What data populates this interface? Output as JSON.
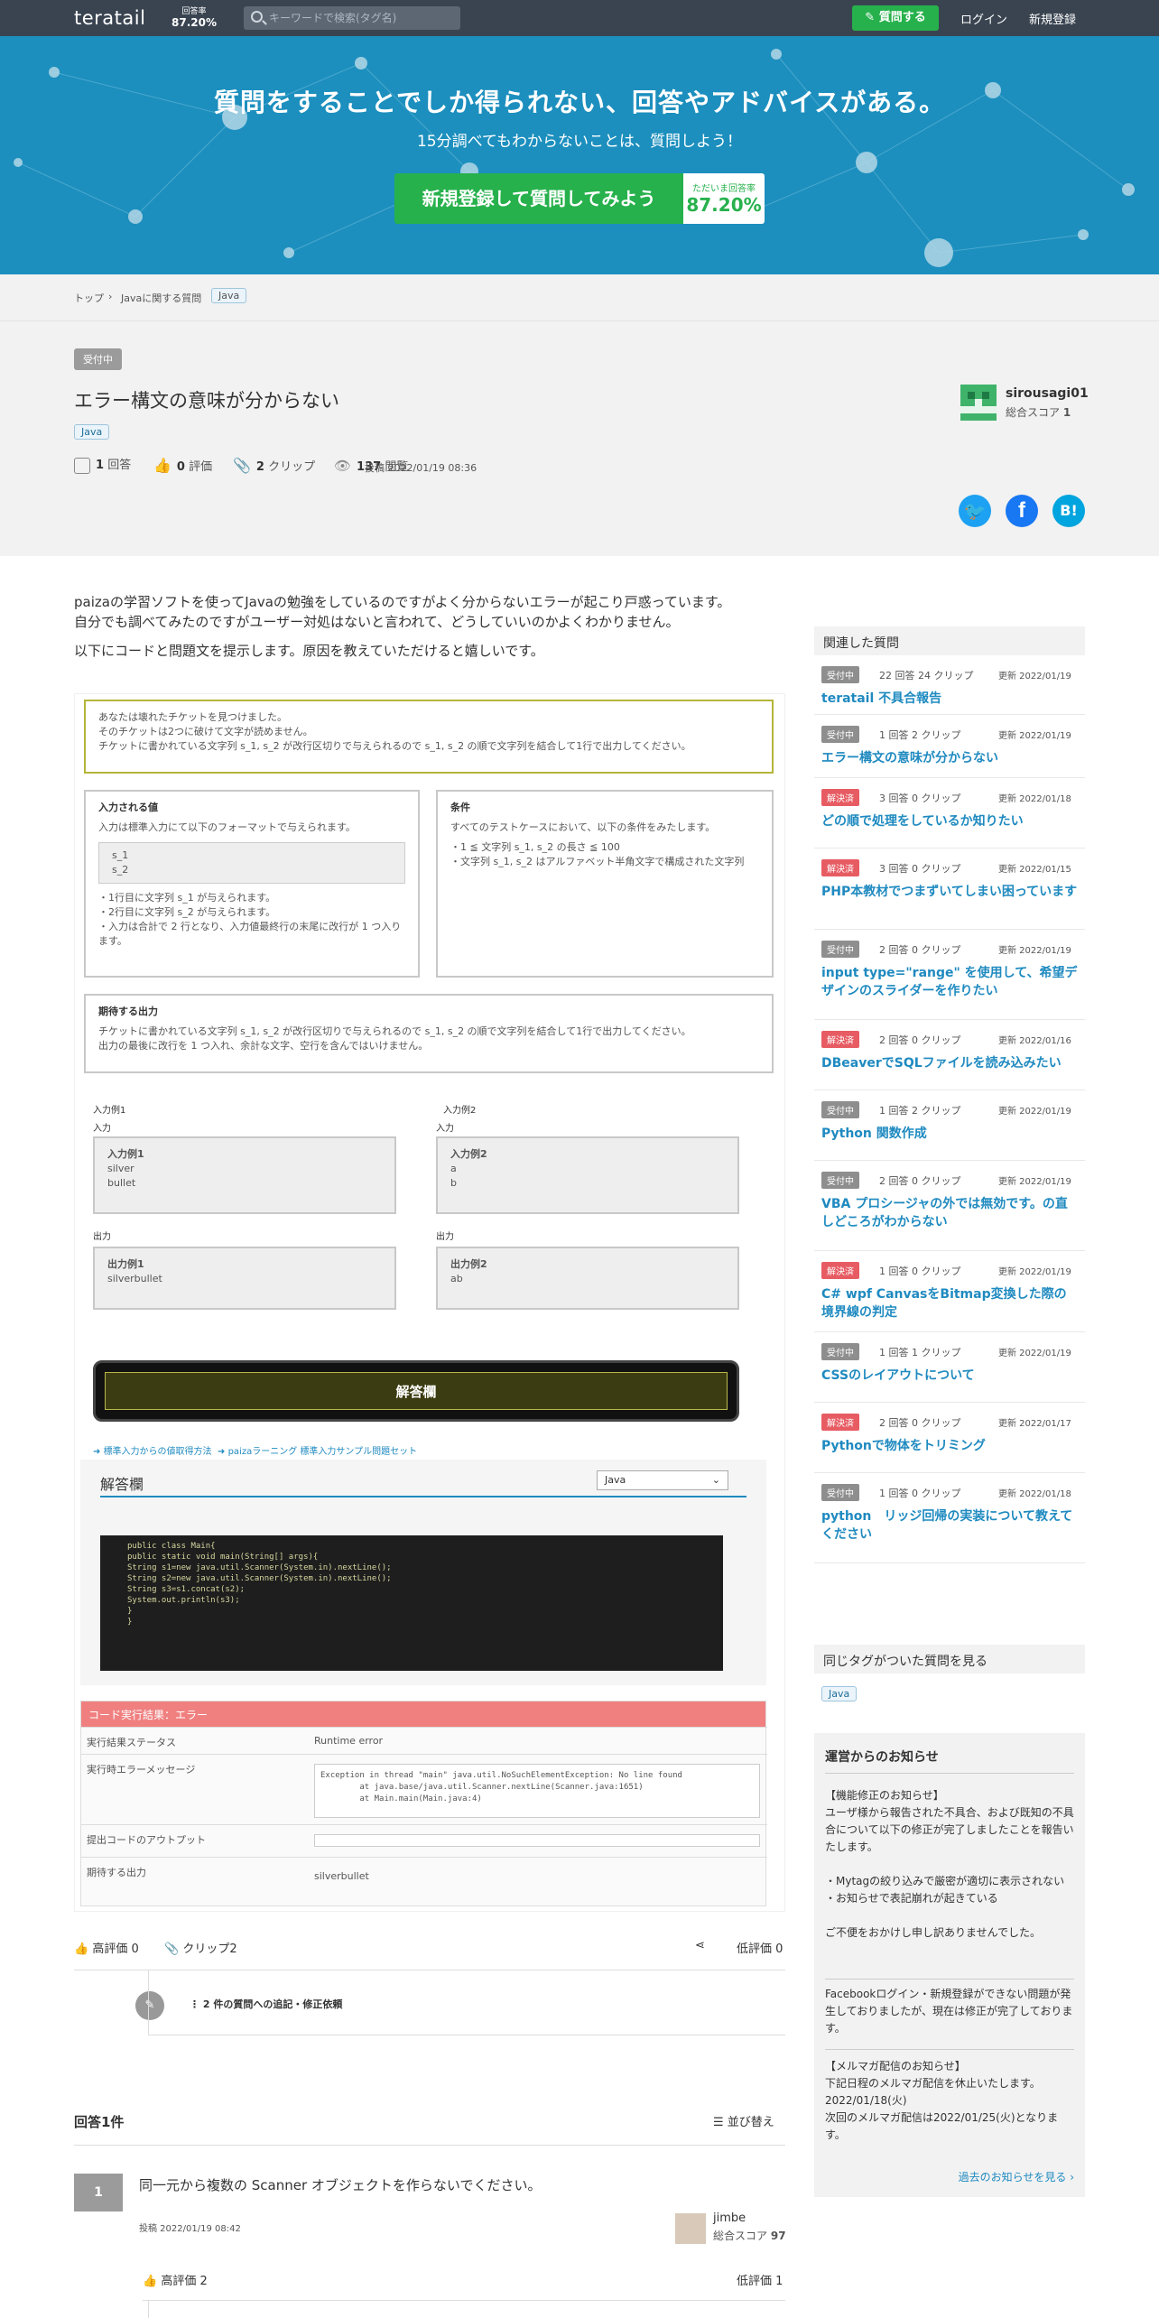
{
  "header": {
    "logo": "teratail",
    "rate_label": "回答率",
    "rate_value": "87.20%",
    "search_placeholder": "キーワードで検索(タグ名)",
    "ask_label": "質問する",
    "login_label": "ログイン",
    "signup_label": "新規登録"
  },
  "hero": {
    "title": "質問をすることでしか得られない、回答やアドバイスがある。",
    "subtitle": "15分調べてもわからないことは、質問しよう！",
    "cta_label": "新規登録して質問してみよう",
    "cta_rate_label": "ただいま回答率",
    "cta_rate_value": "87.20%"
  },
  "breadcrumb": {
    "top": "トップ",
    "category": "Javaに関する質問",
    "tag": "Java"
  },
  "question": {
    "status": "受付中",
    "title": "エラー構文の意味が分からない",
    "tag": "Java",
    "answers": "1",
    "answers_label": "回答",
    "votes": "0",
    "votes_label": "評価",
    "clips": "2",
    "clips_label": "クリップ",
    "views": "137",
    "views_label": "閲覧",
    "posted": "投稿 2022/01/19 08:36",
    "user_name": "sirousagi01",
    "user_score_label": "総合スコア",
    "user_score": "1"
  },
  "body": {
    "p1": "paizaの学習ソフトを使ってJavaの勉強をしているのですがよく分からないエラーが起こり戸惑っています。",
    "p2": "自分でも調べてみたのですがユーザー対処はないと言われて、どうしていいのかよくわかりません。",
    "p3": "以下にコードと問題文を提示します。原因を教えていただけると嬉しいです。"
  },
  "screenshot": {
    "intro1": "あなたは壊れたチケットを見つけました。",
    "intro2": "そのチケットは2つに破けて文字が読めません。",
    "intro3": "チケットに書かれている文字列 s_1, s_2 が改行区切りで与えられるので s_1, s_2 の順で文字列を結合して1行で出力してください。",
    "input_h": "入力される値",
    "input_d": "入力は標準入力にて以下のフォーマットで与えられます。",
    "input_fmt1": "s_1",
    "input_fmt2": "s_2",
    "input_n1": "・1行目に文字列 s_1 が与えられます。",
    "input_n2": "・2行目に文字列 s_2 が与えられます。",
    "input_n3": "・入力は合計で 2 行となり、入力値最終行の末尾に改行が 1 つ入ります。",
    "cond_h": "条件",
    "cond_d": "すべてのテストケースにおいて、以下の条件をみたします。",
    "cond_1": "・1 ≦ 文字列 s_1, s_2 の長さ ≦ 100",
    "cond_2": "・文字列 s_1, s_2 はアルファベット半角文字で構成された文字列",
    "out_h": "期待する出力",
    "out_1": "チケットに書かれている文字列 s_1, s_2 が改行区切りで与えられるので s_1, s_2 の順で文字列を結合して1行で出力してください。",
    "out_2": "出力の最後に改行を 1 つ入れ、余計な文字、空行を含んではいけません。",
    "ex1_h": "入力例1",
    "ex2_h": "入力例2",
    "in_lbl": "入力",
    "out_lbl": "出力",
    "ex1_in_t": "入力例1",
    "ex1_in_a": "silver",
    "ex1_in_b": "bullet",
    "ex2_in_t": "入力例2",
    "ex2_in_a": "a",
    "ex2_in_b": "b",
    "ex1_out_t": "出力例1",
    "ex1_out_v": "silverbullet",
    "ex2_out_t": "出力例2",
    "ex2_out_v": "ab",
    "answer_bar": "解答欄",
    "link1": "標準入力からの値取得方法",
    "link2": "paizaラーニング 標準入力サンプル問題セット",
    "editor_h": "解答欄",
    "lang": "Java",
    "code1": "public class Main{",
    "code2": "    public static void main(String[] args){",
    "code3": "        String s1=new java.util.Scanner(System.in).nextLine();",
    "code4": "        String s2=new java.util.Scanner(System.in).nextLine();",
    "code5": "        String s3=s1.concat(s2);",
    "code6": "        System.out.println(s3);",
    "code7": "    }",
    "code8": "}",
    "result_h": "コード実行結果：エラー",
    "r1_k": "実行結果ステータス",
    "r1_v": "Runtime error",
    "r2_k": "実行時エラーメッセージ",
    "err1": "Exception in thread \"main\" java.util.NoSuchElementException: No line found",
    "err2": "        at java.base/java.util.Scanner.nextLine(Scanner.java:1651)",
    "err3": "        at Main.main(Main.java:4)",
    "r3_k": "提出コードのアウトプット",
    "r4_k": "期待する出力",
    "r4_v": "silverbullet"
  },
  "qactions": {
    "upvote": "高評価 0",
    "clip": "クリップ2",
    "downvote": "低評価 0",
    "edit": "2 件の質問への追記・修正依頼"
  },
  "answers": {
    "heading": "回答1件",
    "sort": "並び替え",
    "a1_vote": "1",
    "a1_text": "同一元から複数の Scanner オブジェクトを作らないでください。",
    "a1_posted": "投稿 2022/01/19 08:42",
    "a1_user": "jimbe",
    "a1_score_label": "総合スコア",
    "a1_score": "97",
    "a1_up": "高評価 2",
    "a1_down": "低評価 1"
  },
  "sidebar": {
    "related_h": "関連した質問",
    "related": [
      {
        "status": "受付中",
        "color": "#8e8e8e",
        "counts": "22 回答  24 クリップ",
        "date": "更新 2022/01/19",
        "title": "teratail 不具合報告"
      },
      {
        "status": "受付中",
        "color": "#8e8e8e",
        "counts": "1 回答  2 クリップ",
        "date": "更新 2022/01/19",
        "title": "エラー構文の意味が分からない"
      },
      {
        "status": "解決済",
        "color": "#e75c63",
        "counts": "3 回答  0 クリップ",
        "date": "更新 2022/01/18",
        "title": "どの順で処理をしているか知りたい"
      },
      {
        "status": "解決済",
        "color": "#e75c63",
        "counts": "3 回答  0 クリップ",
        "date": "更新 2022/01/15",
        "title": "PHP本教材でつまずいてしまい困っています"
      },
      {
        "status": "受付中",
        "color": "#8e8e8e",
        "counts": "2 回答  0 クリップ",
        "date": "更新 2022/01/19",
        "title": "input type=\"range\" を使用して、希望デザインのスライダーを作りたい"
      },
      {
        "status": "解決済",
        "color": "#e75c63",
        "counts": "2 回答  0 クリップ",
        "date": "更新 2022/01/16",
        "title": "DBeaverでSQLファイルを読み込みたい"
      },
      {
        "status": "受付中",
        "color": "#8e8e8e",
        "counts": "1 回答  2 クリップ",
        "date": "更新 2022/01/19",
        "title": "Python 関数作成"
      },
      {
        "status": "受付中",
        "color": "#8e8e8e",
        "counts": "2 回答  0 クリップ",
        "date": "更新 2022/01/19",
        "title": "VBA プロシージャの外では無効です。の直しどころがわからない"
      },
      {
        "status": "解決済",
        "color": "#e75c63",
        "counts": "1 回答  0 クリップ",
        "date": "更新 2022/01/19",
        "title": "C# wpf CanvasをBitmap変換した際の境界線の判定"
      },
      {
        "status": "受付中",
        "color": "#8e8e8e",
        "counts": "1 回答  1 クリップ",
        "date": "更新 2022/01/19",
        "title": "CSSのレイアウトについて"
      },
      {
        "status": "解決済",
        "color": "#e75c63",
        "counts": "2 回答  0 クリップ",
        "date": "更新 2022/01/17",
        "title": "Pythonで物体をトリミング"
      },
      {
        "status": "受付中",
        "color": "#8e8e8e",
        "counts": "1 回答  0 クリップ",
        "date": "更新 2022/01/18",
        "title": "python　リッジ回帰の実装について教えてください"
      }
    ],
    "sametag_h": "同じタグがついた質問を見る",
    "sametag": "Java",
    "notice_h": "運営からのお知らせ",
    "n1a": "【機能修正のお知らせ】",
    "n1b": "ユーザ様から報告された不具合、および既知の不具合について以下の修正が完了しましたことを報告いたします。",
    "n1c": "・Mytagの絞り込みで厳密が適切に表示されない",
    "n1d": "・お知らせで表記崩れが起きている",
    "n1e": "ご不便をおかけし申し訳ありませんでした。",
    "n2": "Facebookログイン・新規登録ができない問題が発生しておりましたが、現在は修正が完了しております。",
    "n3a": "【メルマガ配信のお知らせ】",
    "n3b": "下記日程のメルマガ配信を休止いたします。",
    "n3c": "2022/01/18(火)",
    "n3d": "次回のメルマガ配信は2022/01/25(火)となります。",
    "more": "過去のお知らせを見る ›"
  }
}
